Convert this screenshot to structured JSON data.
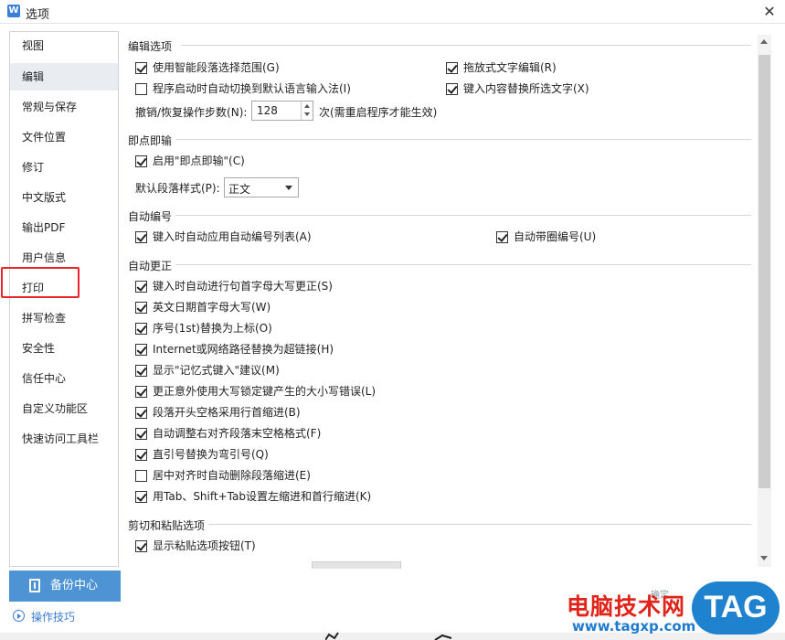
{
  "window": {
    "title": "选项",
    "app_icon": "W"
  },
  "sidebar": {
    "items": [
      {
        "label": "视图"
      },
      {
        "label": "编辑",
        "active": true
      },
      {
        "label": "常规与保存"
      },
      {
        "label": "文件位置"
      },
      {
        "label": "修订"
      },
      {
        "label": "中文版式"
      },
      {
        "label": "输出PDF"
      },
      {
        "label": "用户信息"
      },
      {
        "label": "打印",
        "highlighted": true
      },
      {
        "label": "拼写检查"
      },
      {
        "label": "安全性"
      },
      {
        "label": "信任中心"
      },
      {
        "label": "自定义功能区"
      },
      {
        "label": "快速访问工具栏"
      }
    ],
    "backup_label": "备份中心",
    "tips_label": "操作技巧"
  },
  "edit_options": {
    "title": "编辑选项",
    "smart_select": {
      "label": "使用智能段落选择范围(G)",
      "checked": true
    },
    "drag_edit": {
      "label": "拖放式文字编辑(R)",
      "checked": true
    },
    "auto_switch_ime": {
      "label": "程序启动时自动切换到默认语言输入法(I)",
      "checked": false
    },
    "typing_replaces": {
      "label": "键入内容替换所选文字(X)",
      "checked": true
    },
    "undo_label": "撤销/恢复操作步数(N):",
    "undo_steps": "128",
    "undo_suffix": "次(需重启程序才能生效)"
  },
  "click_and_type": {
    "title": "即点即输",
    "enable": {
      "label": "启用\"即点即输\"(C)",
      "checked": true
    },
    "para_style_label": "默认段落样式(P):",
    "para_style_value": "正文"
  },
  "auto_numbering": {
    "title": "自动编号",
    "apply_list": {
      "label": "键入时自动应用自动编号列表(A)",
      "checked": true
    },
    "circled": {
      "label": "自动带圈编号(U)",
      "checked": true
    }
  },
  "autocorrect": {
    "title": "自动更正",
    "items": [
      {
        "label": "键入时自动进行句首字母大写更正(S)",
        "checked": true
      },
      {
        "label": "英文日期首字母大写(W)",
        "checked": true
      },
      {
        "label": "序号(1st)替换为上标(O)",
        "checked": true
      },
      {
        "label": "Internet或网络路径替换为超链接(H)",
        "checked": true
      },
      {
        "label": "显示\"记忆式键入\"建议(M)",
        "checked": true
      },
      {
        "label": "更正意外使用大写锁定键产生的大小写错误(L)",
        "checked": true
      },
      {
        "label": "段落开头空格采用行首缩进(B)",
        "checked": true
      },
      {
        "label": "自动调整右对齐段落末空格格式(F)",
        "checked": true
      },
      {
        "label": "直引号替换为弯引号(Q)",
        "checked": true
      },
      {
        "label": "居中对齐时自动删除段落缩进(E)",
        "checked": false
      },
      {
        "label": "用Tab、Shift+Tab设置左缩进和首行缩进(K)",
        "checked": true
      }
    ]
  },
  "cut_paste": {
    "title": "剪切和粘贴选项",
    "show_paste_button": {
      "label": "显示粘贴选项按钮(T)",
      "checked": true
    }
  },
  "footer": {
    "ok_label": "确定"
  },
  "watermark": {
    "site_name": "电脑技术网",
    "url": "www.tagxp.com",
    "badge": "TAG"
  }
}
